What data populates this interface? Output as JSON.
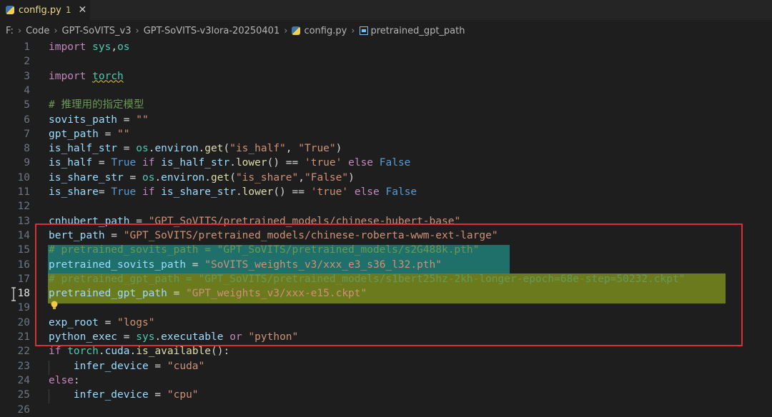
{
  "tab": {
    "filename": "config.py",
    "badge": "1",
    "close_glyph": "✕"
  },
  "breadcrumb": [
    "F:",
    "Code",
    "GPT-SoVITS_v3",
    "GPT-SoVITS-v3lora-20250401",
    "config.py",
    "pretrained_gpt_path"
  ],
  "active_line": "18",
  "lines": [
    {
      "n": "1",
      "tokens": [
        [
          "kw",
          "import"
        ],
        [
          "plain",
          " "
        ],
        [
          "mod",
          "sys"
        ],
        [
          "plain",
          ","
        ],
        [
          "mod",
          "os"
        ]
      ]
    },
    {
      "n": "2",
      "tokens": []
    },
    {
      "n": "3",
      "tokens": [
        [
          "kw",
          "import"
        ],
        [
          "plain",
          " "
        ],
        [
          "mod sq",
          "torch"
        ]
      ]
    },
    {
      "n": "4",
      "tokens": []
    },
    {
      "n": "5",
      "tokens": [
        [
          "cm",
          "# 推理用的指定模型"
        ]
      ]
    },
    {
      "n": "6",
      "tokens": [
        [
          "id",
          "sovits_path"
        ],
        [
          "plain",
          " = "
        ],
        [
          "str",
          "\"\""
        ]
      ]
    },
    {
      "n": "7",
      "tokens": [
        [
          "id",
          "gpt_path"
        ],
        [
          "plain",
          " = "
        ],
        [
          "str",
          "\"\""
        ]
      ]
    },
    {
      "n": "8",
      "tokens": [
        [
          "id",
          "is_half_str"
        ],
        [
          "plain",
          " = "
        ],
        [
          "mod",
          "os"
        ],
        [
          "plain",
          "."
        ],
        [
          "id",
          "environ"
        ],
        [
          "plain",
          "."
        ],
        [
          "fn",
          "get"
        ],
        [
          "plain",
          "("
        ],
        [
          "str",
          "\"is_half\""
        ],
        [
          "plain",
          ", "
        ],
        [
          "str",
          "\"True\""
        ],
        [
          "plain",
          ")"
        ]
      ]
    },
    {
      "n": "9",
      "tokens": [
        [
          "id",
          "is_half"
        ],
        [
          "plain",
          " = "
        ],
        [
          "bool",
          "True"
        ],
        [
          "plain",
          " "
        ],
        [
          "kw",
          "if"
        ],
        [
          "plain",
          " "
        ],
        [
          "id",
          "is_half_str"
        ],
        [
          "plain",
          "."
        ],
        [
          "fn",
          "lower"
        ],
        [
          "plain",
          "() == "
        ],
        [
          "str",
          "'true'"
        ],
        [
          "plain",
          " "
        ],
        [
          "kw",
          "else"
        ],
        [
          "plain",
          " "
        ],
        [
          "bool",
          "False"
        ]
      ]
    },
    {
      "n": "10",
      "tokens": [
        [
          "id",
          "is_share_str"
        ],
        [
          "plain",
          " = "
        ],
        [
          "mod",
          "os"
        ],
        [
          "plain",
          "."
        ],
        [
          "id",
          "environ"
        ],
        [
          "plain",
          "."
        ],
        [
          "fn",
          "get"
        ],
        [
          "plain",
          "("
        ],
        [
          "str",
          "\"is_share\""
        ],
        [
          "plain",
          ","
        ],
        [
          "str",
          "\"False\""
        ],
        [
          "plain",
          ")"
        ]
      ]
    },
    {
      "n": "11",
      "tokens": [
        [
          "id",
          "is_share"
        ],
        [
          "plain",
          "= "
        ],
        [
          "bool",
          "True"
        ],
        [
          "plain",
          " "
        ],
        [
          "kw",
          "if"
        ],
        [
          "plain",
          " "
        ],
        [
          "id",
          "is_share_str"
        ],
        [
          "plain",
          "."
        ],
        [
          "fn",
          "lower"
        ],
        [
          "plain",
          "() == "
        ],
        [
          "str",
          "'true'"
        ],
        [
          "plain",
          " "
        ],
        [
          "kw",
          "else"
        ],
        [
          "plain",
          " "
        ],
        [
          "bool",
          "False"
        ]
      ]
    },
    {
      "n": "12",
      "tokens": []
    },
    {
      "n": "13",
      "tokens": [
        [
          "id",
          "cnhubert_path"
        ],
        [
          "plain",
          " = "
        ],
        [
          "str",
          "\"GPT_SoVITS/pretrained_models/chinese-hubert-base\""
        ]
      ]
    },
    {
      "n": "14",
      "tokens": [
        [
          "id",
          "bert_path"
        ],
        [
          "plain",
          " = "
        ],
        [
          "str",
          "\"GPT_SoVITS/pretrained_models/chinese-roberta-wwm-ext-large\""
        ]
      ]
    },
    {
      "n": "15",
      "tokens": [
        [
          "cm",
          "# pretrained_sovits_path = \"GPT_SoVITS/pretrained_models/s2G488k.pth\""
        ]
      ]
    },
    {
      "n": "16",
      "tokens": [
        [
          "id",
          "pretrained_sovits_path"
        ],
        [
          "plain",
          " = "
        ],
        [
          "str",
          "\"SoVITS_weights_v3/xxx_e3_s36_l32.pth\""
        ]
      ]
    },
    {
      "n": "17",
      "tokens": [
        [
          "cm",
          "# pretrained_gpt_path = \"GPT_SoVITS/pretrained_models/s1bert25hz-2kh-longer-epoch=68e-step=50232.ckpt\""
        ]
      ]
    },
    {
      "n": "18",
      "tokens": [
        [
          "id",
          "pretrained_gpt_path"
        ],
        [
          "plain",
          " = "
        ],
        [
          "str",
          "\"GPT_weights_v3/xxx-e15.ckpt\""
        ]
      ]
    },
    {
      "n": "19",
      "tokens": []
    },
    {
      "n": "20",
      "tokens": [
        [
          "id",
          "exp_root"
        ],
        [
          "plain",
          " = "
        ],
        [
          "str",
          "\"logs\""
        ]
      ]
    },
    {
      "n": "21",
      "tokens": [
        [
          "id",
          "python_exec"
        ],
        [
          "plain",
          " = "
        ],
        [
          "mod",
          "sys"
        ],
        [
          "plain",
          "."
        ],
        [
          "id",
          "executable"
        ],
        [
          "plain",
          " "
        ],
        [
          "kw",
          "or"
        ],
        [
          "plain",
          " "
        ],
        [
          "str",
          "\"python\""
        ]
      ]
    },
    {
      "n": "22",
      "tokens": [
        [
          "kw",
          "if"
        ],
        [
          "plain",
          " "
        ],
        [
          "mod",
          "torch"
        ],
        [
          "plain",
          "."
        ],
        [
          "id",
          "cuda"
        ],
        [
          "plain",
          "."
        ],
        [
          "fn",
          "is_available"
        ],
        [
          "plain",
          "():"
        ]
      ]
    },
    {
      "n": "23",
      "tokens": [
        [
          "plain",
          "    "
        ],
        [
          "id",
          "infer_device"
        ],
        [
          "plain",
          " = "
        ],
        [
          "str",
          "\"cuda\""
        ]
      ]
    },
    {
      "n": "24",
      "tokens": [
        [
          "kw",
          "else"
        ],
        [
          "plain",
          ":"
        ]
      ]
    },
    {
      "n": "25",
      "tokens": [
        [
          "plain",
          "    "
        ],
        [
          "id",
          "infer_device"
        ],
        [
          "plain",
          " = "
        ],
        [
          "str",
          "\"cpu\""
        ]
      ]
    },
    {
      "n": "26",
      "tokens": []
    }
  ],
  "colors": {
    "highlight_teal": "#1f6f6a",
    "highlight_olive": "#6b7a1c",
    "annotation_box": "#d8312f"
  },
  "icons": {
    "tab": "python-file-icon",
    "breadcrumb_file": "python-file-icon",
    "breadcrumb_symbol": "variable-symbol-icon",
    "gutter": "lightbulb-icon"
  }
}
